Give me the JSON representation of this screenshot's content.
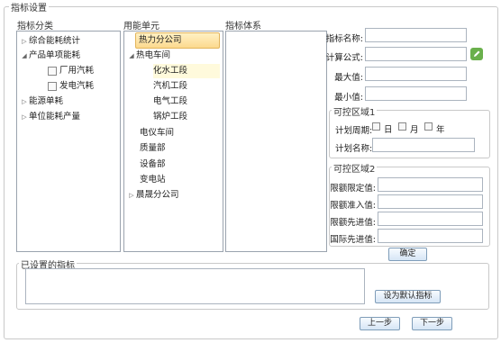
{
  "window_title": "指标设置",
  "columns": {
    "category": "指标分类",
    "unit": "用能单元",
    "system": "指标体系"
  },
  "category_tree": [
    {
      "label": "综合能耗统计"
    },
    {
      "label": "产品单项能耗"
    },
    {
      "label": "厂用汽耗"
    },
    {
      "label": "发电汽耗"
    },
    {
      "label": "能源单耗"
    },
    {
      "label": "单位能耗产量"
    }
  ],
  "unit_tree": [
    {
      "label": "热力分公司"
    },
    {
      "label": "热电车间"
    },
    {
      "label": "化水工段"
    },
    {
      "label": "汽机工段"
    },
    {
      "label": "电气工段"
    },
    {
      "label": "锅炉工段"
    },
    {
      "label": "电仪车间"
    },
    {
      "label": "质量部"
    },
    {
      "label": "设备部"
    },
    {
      "label": "变电站"
    },
    {
      "label": "晨晟分公司"
    }
  ],
  "form": {
    "name_label": "指标名称:",
    "name_value": "",
    "formula_label": "计算公式:",
    "formula_value": "",
    "max_label": "最大值:",
    "max_value": "",
    "min_label": "最小值:",
    "min_value": ""
  },
  "region1": {
    "title": "可控区域1",
    "period_label": "计划周期:",
    "options": [
      "日",
      "月",
      "年"
    ],
    "plan_name_label": "计划名称:",
    "plan_name_value": ""
  },
  "region2": {
    "title": "可控区域2",
    "fields": [
      {
        "label": "限额限定值:",
        "value": ""
      },
      {
        "label": "限额准入值:",
        "value": ""
      },
      {
        "label": "限额先进值:",
        "value": ""
      },
      {
        "label": "国际先进值:",
        "value": ""
      }
    ]
  },
  "buttons": {
    "confirm": "确定",
    "set_default": "设为默认指标",
    "prev": "上一步",
    "next": "下一步"
  },
  "configured": {
    "title": "已设置的指标",
    "value": ""
  },
  "colors": {
    "selection": "#fcd98e",
    "edit_icon": "#6ab04c"
  }
}
